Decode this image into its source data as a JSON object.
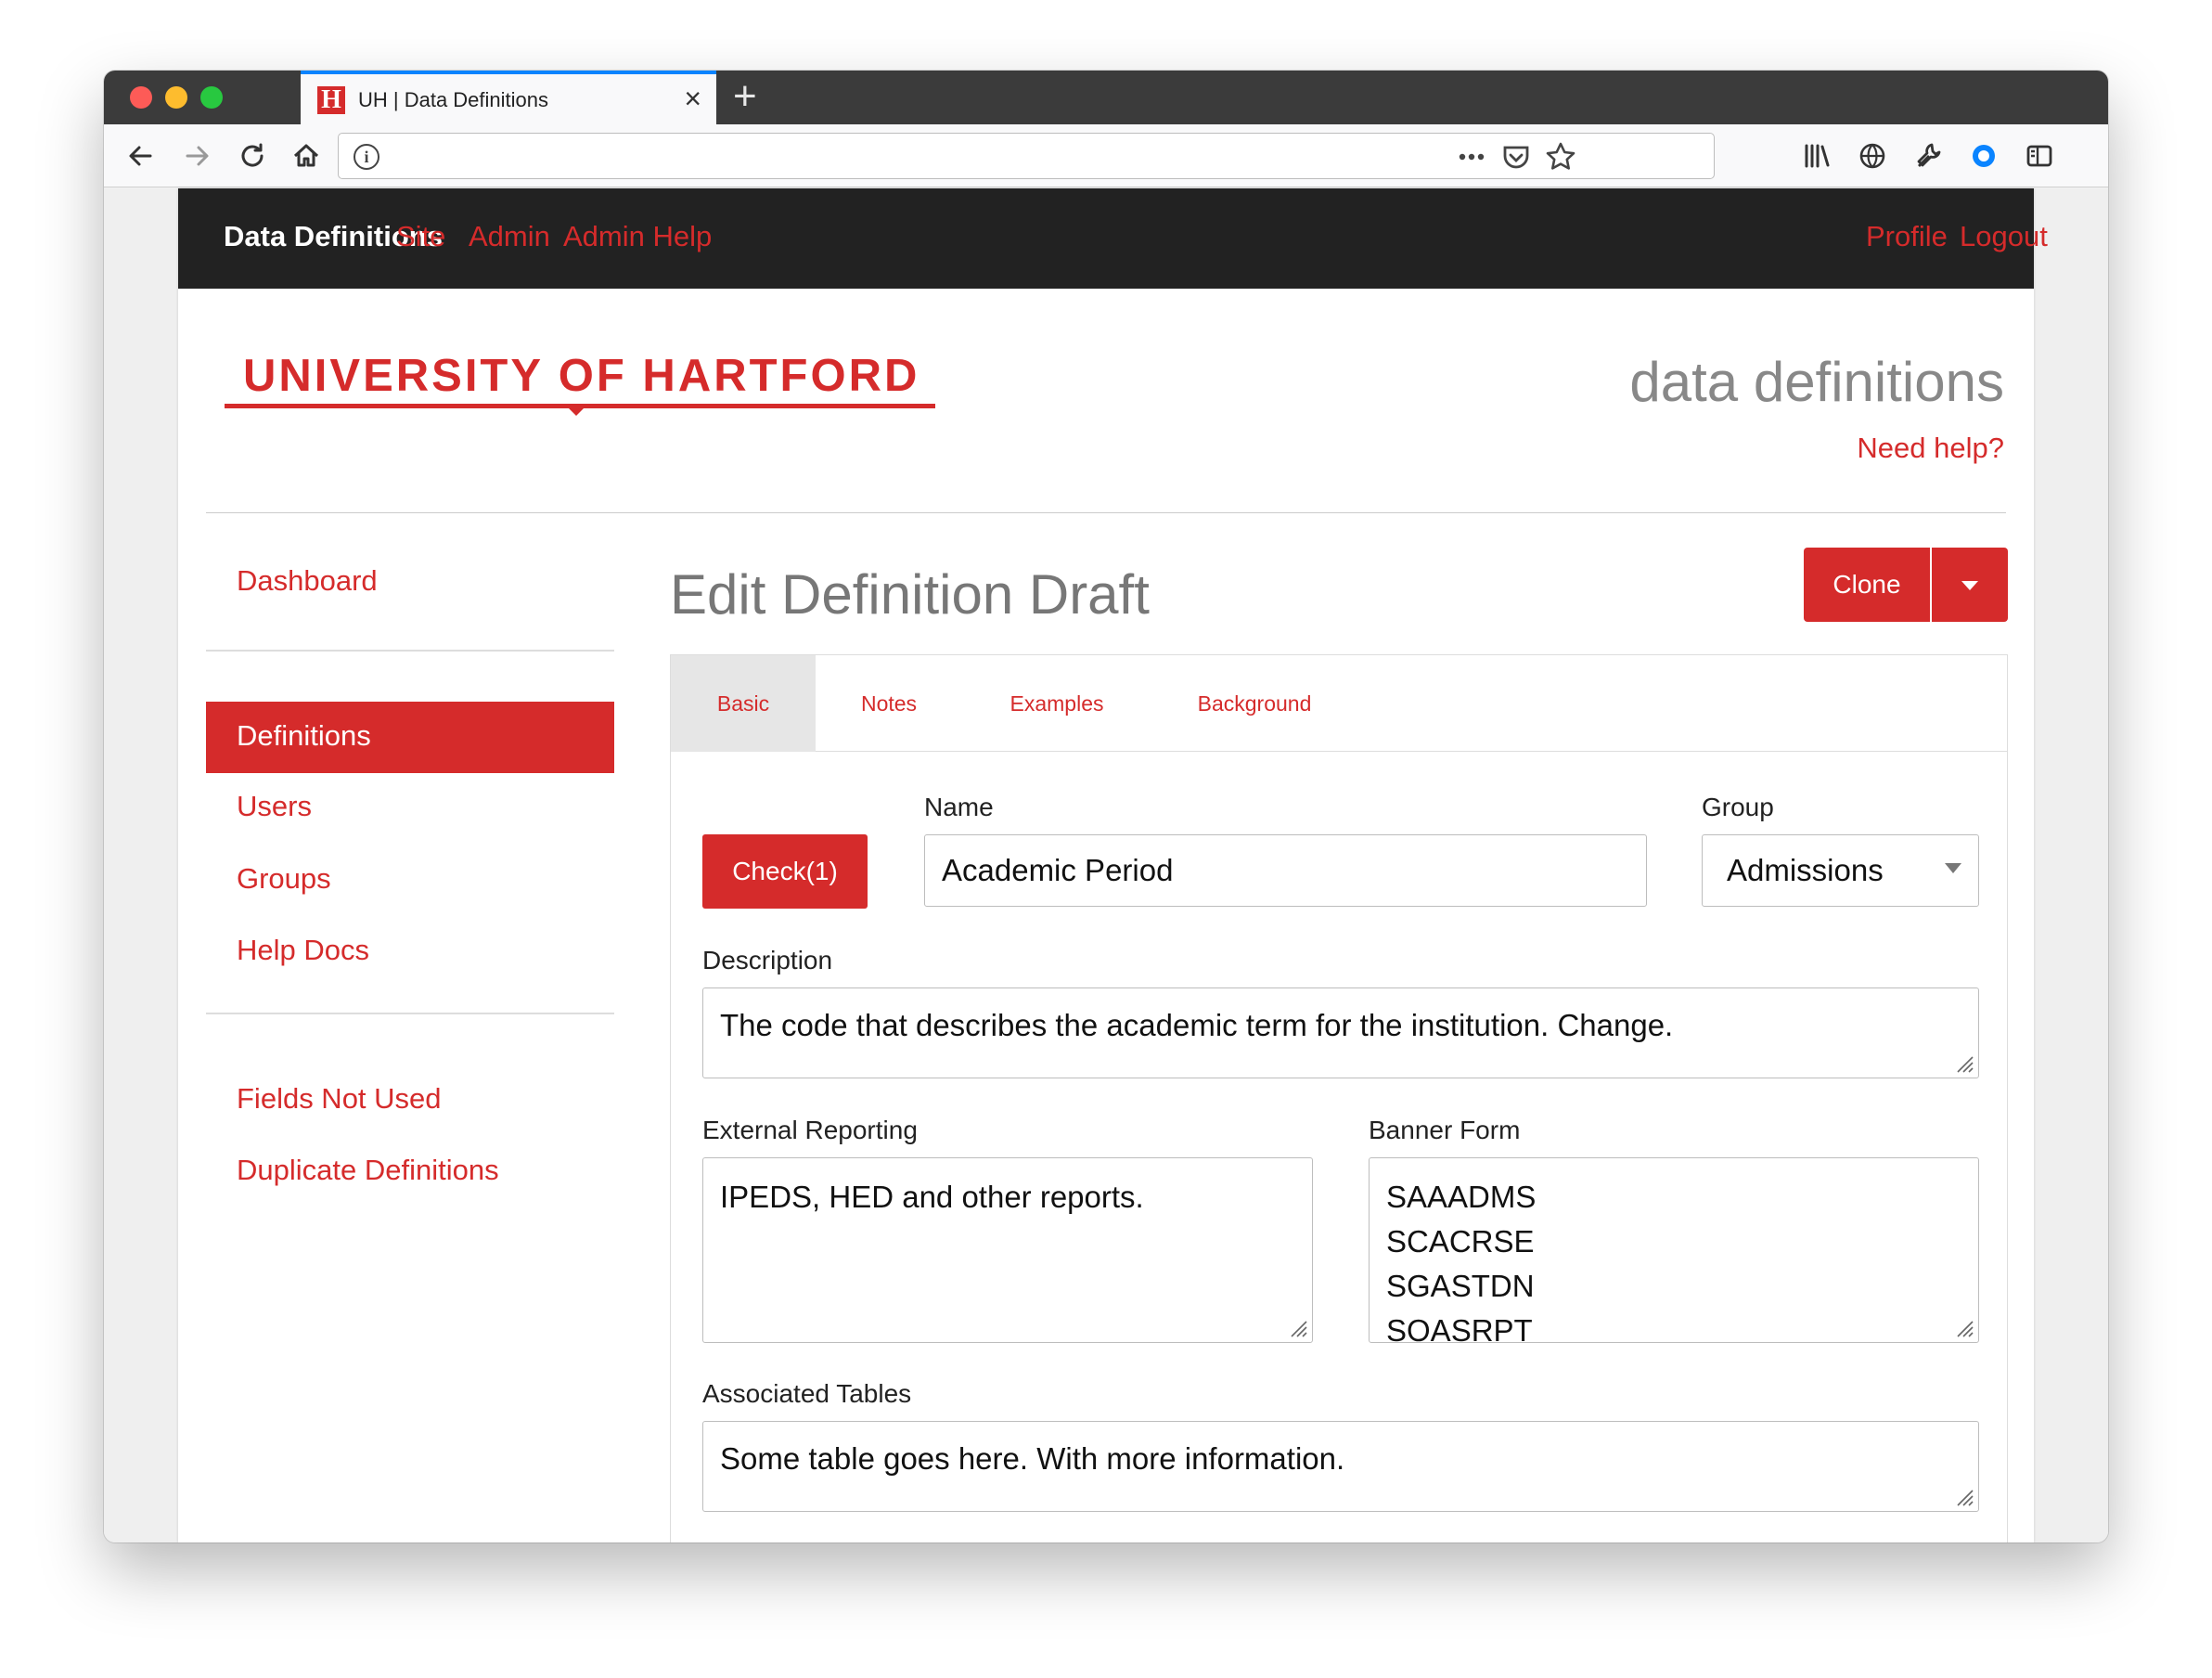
{
  "browser": {
    "tab_title": "UH | Data Definitions",
    "tab_favicon": "H",
    "tab_close": "×",
    "new_tab": "+"
  },
  "topnav": {
    "brand": "Data Definitions",
    "links_left": [
      "Site",
      "Admin",
      "Admin Help"
    ],
    "links_right": [
      "Profile",
      "Logout"
    ]
  },
  "header": {
    "logo_text": "UNIVERSITY OF HARTFORD",
    "site_title": "data definitions",
    "help_link": "Need help?"
  },
  "sidebar": {
    "dashboard": "Dashboard",
    "active": "Definitions",
    "items": [
      "Users",
      "Groups",
      "Help Docs"
    ],
    "extra": [
      "Fields Not Used",
      "Duplicate Definitions"
    ]
  },
  "main": {
    "heading": "Edit Definition Draft",
    "clone_button": "Clone",
    "tabs": [
      "Basic",
      "Notes",
      "Examples",
      "Background"
    ],
    "check_button": "Check(1)",
    "name_label": "Name",
    "name_value": "Academic Period",
    "group_label": "Group",
    "group_value": "Admissions",
    "description_label": "Description",
    "description_value": "The code that describes the academic term for the institution. Change.",
    "external_label": "External Reporting",
    "external_value": "IPEDS, HED and other reports.",
    "banner_label": "Banner Form",
    "banner_lines": [
      "SAAADMS",
      "SCACRSE",
      "SGASTDN",
      "SOASRPT"
    ],
    "tables_label": "Associated Tables",
    "tables_value": "Some table goes here. With more information."
  },
  "colors": {
    "brand_red": "#d52b2b",
    "navbar_dark": "#222222"
  }
}
